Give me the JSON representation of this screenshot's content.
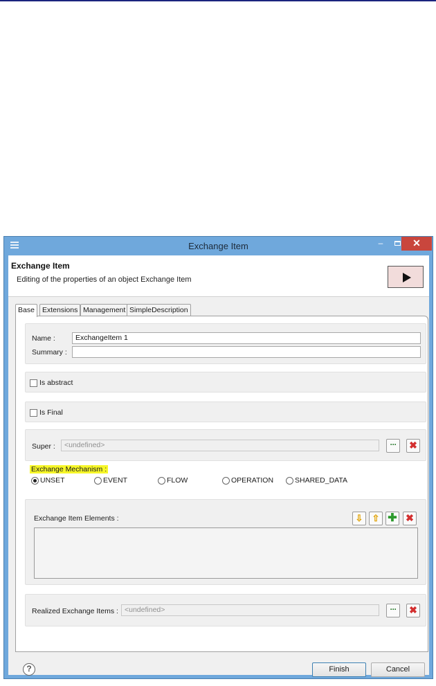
{
  "window": {
    "title": "Exchange Item",
    "minimize_glyph": "–",
    "close_glyph": "✕"
  },
  "header": {
    "title": "Exchange Item",
    "subtitle": "Editing of the properties of an object Exchange Item",
    "icon": "play-arrow-icon"
  },
  "tabs": [
    "Base",
    "Extensions",
    "Management",
    "SimpleDescription"
  ],
  "form": {
    "name_label": "Name :",
    "name_value": "ExchangeItem 1",
    "summary_label": "Summary :",
    "summary_value": "",
    "is_abstract_label": "Is abstract",
    "is_abstract_checked": false,
    "is_final_label": "Is Final",
    "is_final_checked": false,
    "super_label": "Super :",
    "super_placeholder": "<undefined>",
    "browse_glyph": "···",
    "delete_glyph": "✖",
    "mechanism_label": "Exchange Mechanism :",
    "mechanism_options": [
      "UNSET",
      "EVENT",
      "FLOW",
      "OPERATION",
      "SHARED_DATA"
    ],
    "mechanism_selected": "UNSET",
    "elements_label": "Exchange Item Elements :",
    "down_glyph": "⇩",
    "up_glyph": "⇧",
    "add_glyph": "✚",
    "realized_label": "Realized Exchange Items :",
    "realized_placeholder": "<undefined>"
  },
  "footer": {
    "help_glyph": "?",
    "finish_label": "Finish",
    "cancel_label": "Cancel"
  },
  "colors": {
    "titlebar": "#6fa8dc",
    "close": "#c9463d",
    "highlight": "#f6f628",
    "delete": "#d32f2f",
    "browse": "#2e7d32"
  }
}
